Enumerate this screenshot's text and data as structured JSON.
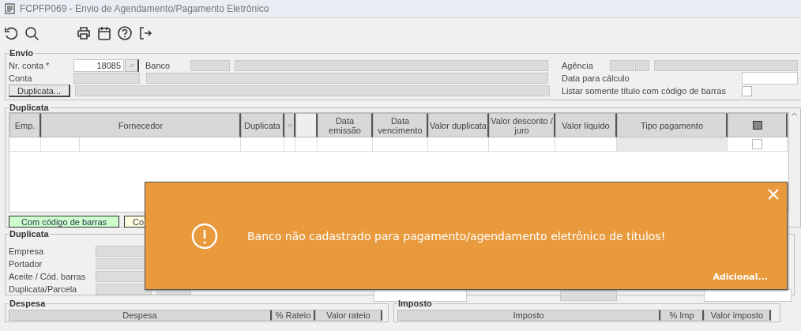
{
  "window": {
    "title": "FCPFP069 - Envio de Agendamento/Pagamento Eletrônico"
  },
  "envio": {
    "legend": "Envio",
    "nr_conta": {
      "label": "Nr. conta *",
      "value": "18085"
    },
    "banco": {
      "label": "Banco"
    },
    "agencia": {
      "label": "Agência"
    },
    "conta": {
      "label": "Conta"
    },
    "data_calculo": {
      "label": "Data para cálculo"
    },
    "duplicata_button": {
      "label": "Duplicata..."
    },
    "listar": {
      "label": "Listar somente título com código de barras",
      "checked": false
    }
  },
  "duplicata_grid": {
    "legend": "Duplicata",
    "columns": [
      {
        "kind": "text",
        "label": "Emp."
      },
      {
        "kind": "text",
        "label": "Fornecedor"
      },
      {
        "kind": "text",
        "label": "Duplicata"
      },
      {
        "kind": "icon"
      },
      {
        "kind": "blank"
      },
      {
        "kind": "text",
        "label": "Data emissão"
      },
      {
        "kind": "text",
        "label": "Data vencimento"
      },
      {
        "kind": "text",
        "label": "Valor duplicata"
      },
      {
        "kind": "text",
        "label": "Valor desconto / juro"
      },
      {
        "kind": "text",
        "label": "Valor líquido"
      },
      {
        "kind": "text",
        "label": "Tipo pagamento"
      },
      {
        "kind": "check"
      }
    ],
    "rows": [
      {
        "checked": false
      }
    ],
    "legend_buttons": [
      {
        "label": "Com código de barras",
        "color": "#ccffcc"
      },
      {
        "label": "Co",
        "color": "#ffffe0"
      }
    ]
  },
  "duplicata_details": {
    "legend": "Duplicata",
    "labels": [
      "Empresa",
      "Portador",
      "Aceite / Cód. barras",
      "Duplicata/Parcela"
    ]
  },
  "despesa": {
    "legend": "Despesa",
    "columns": [
      "Despesa",
      "% Rateio",
      "Valor rateio"
    ]
  },
  "imposto": {
    "legend": "Imposto",
    "columns": [
      "Imposto",
      "% Imp",
      "Valor imposto"
    ]
  },
  "toast": {
    "message": "Banco não cadastrado para pagamento/agendamento eletrônico de titulos!",
    "link": "Adicional..."
  }
}
